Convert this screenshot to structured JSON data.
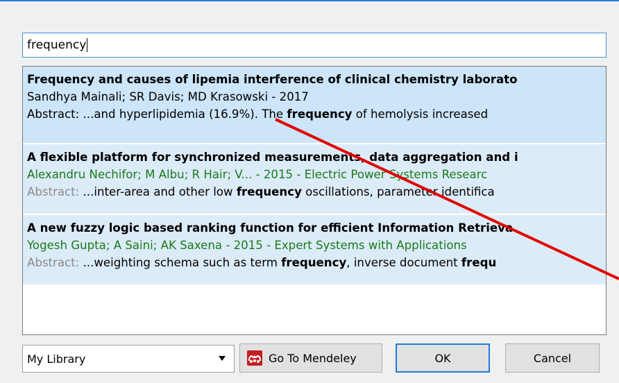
{
  "search": {
    "value": "frequency"
  },
  "results": [
    {
      "title": "Frequency and causes of lipemia interference of clinical chemistry laborato",
      "authors": "Sandhya Mainali; SR Davis; MD Krasowski - 2017",
      "abstract_label": "Abstract:",
      "abstract_pre": " ...and hyperlipidemia (16.9%). The ",
      "abstract_kw": "frequency",
      "abstract_post": " of hemolysis increased "
    },
    {
      "title": "A flexible platform for synchronized measurements, data aggregation and i",
      "authors": "Alexandru Nechifor; M Albu; R Hair; V... - 2015 - Electric Power Systems Researc",
      "abstract_label": "Abstract:",
      "abstract_pre": " ...inter-area and other low ",
      "abstract_kw": "frequency",
      "abstract_post": " oscillations, parameter identifica"
    },
    {
      "title": "A new fuzzy logic based ranking function for efficient Information Retrieva",
      "authors": "Yogesh Gupta; A Saini; AK Saxena - 2015 - Expert Systems with Applications",
      "abstract_label": "Abstract:",
      "abstract_pre": " ...weighting schema such as term ",
      "abstract_kw": "frequency",
      "abstract_post": ", inverse document ",
      "abstract_kw2": "frequ"
    }
  ],
  "footer": {
    "library_select": "My Library",
    "goto_label": "Go To Mendeley",
    "ok_label": "OK",
    "cancel_label": "Cancel"
  },
  "colors": {
    "accent": "#1e7bd6",
    "selected_row": "#cce5f8",
    "author_green": "#1a7a1a",
    "mendeley_red": "#c41e23",
    "annotation_red": "#e00000"
  },
  "icons": {
    "dropdown": "chevron-down-icon",
    "mendeley": "mendeley-logo-icon"
  }
}
